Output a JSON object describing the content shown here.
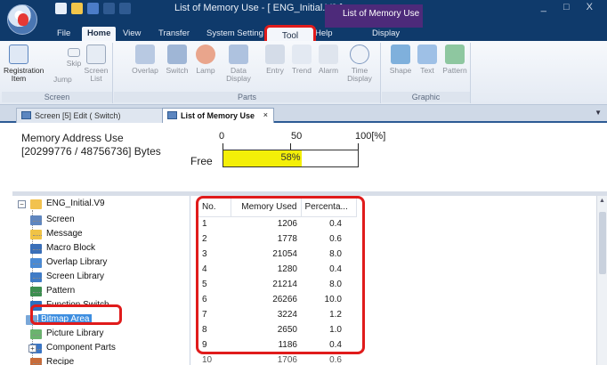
{
  "window": {
    "title": "List of Memory Use - [ ENG_Initial.V9 ]",
    "context_tab_group": "List of Memory Use",
    "controls": "_ □ X"
  },
  "ribbon_tabs": [
    "File",
    "Home",
    "View",
    "Transfer",
    "System Setting",
    "Tool",
    "Help",
    "Display"
  ],
  "window_style": "Window Style",
  "ribbon": {
    "screen_group": {
      "label": "Screen",
      "registration": "Registration Item",
      "skip": "Skip",
      "jump": "Jump",
      "screen_list": "Screen List"
    },
    "parts_group": {
      "label": "Parts",
      "items": [
        "Overlap",
        "Switch",
        "Lamp",
        "Data Display",
        "Entry",
        "Trend",
        "Alarm",
        "Time Display"
      ]
    },
    "graphic_group": {
      "label": "Graphic",
      "items": [
        "Shape",
        "Text",
        "Pattern"
      ]
    }
  },
  "doc_tabs": {
    "inactive": "Screen [5] Edit (     Switch)",
    "active": "List of Memory Use",
    "close": "×"
  },
  "memory": {
    "title": "Memory Address Use",
    "bytes": "[20299776 / 48756736] Bytes",
    "free_label": "Free",
    "scale": [
      "0",
      "50",
      "100[%]"
    ],
    "bar_text": "58%",
    "bar_fraction": 0.58
  },
  "tree": {
    "root": "ENG_Initial.V9",
    "items": [
      "Screen",
      "Message",
      "Macro Block",
      "Overlap Library",
      "Screen Library",
      "Pattern",
      "Function Switch",
      "Bitmap Area",
      "Picture Library",
      "Component Parts",
      "Recipe"
    ]
  },
  "table": {
    "headers": [
      "No.",
      "Memory Used",
      "Percenta..."
    ],
    "rows": [
      [
        "1",
        "1206",
        "0.4"
      ],
      [
        "2",
        "1778",
        "0.6"
      ],
      [
        "3",
        "21054",
        "8.0"
      ],
      [
        "4",
        "1280",
        "0.4"
      ],
      [
        "5",
        "21214",
        "8.0"
      ],
      [
        "6",
        "26266",
        "10.0"
      ],
      [
        "7",
        "3224",
        "1.2"
      ],
      [
        "8",
        "2650",
        "1.0"
      ],
      [
        "9",
        "1186",
        "0.4"
      ],
      [
        "10",
        "1706",
        "0.6"
      ]
    ]
  }
}
